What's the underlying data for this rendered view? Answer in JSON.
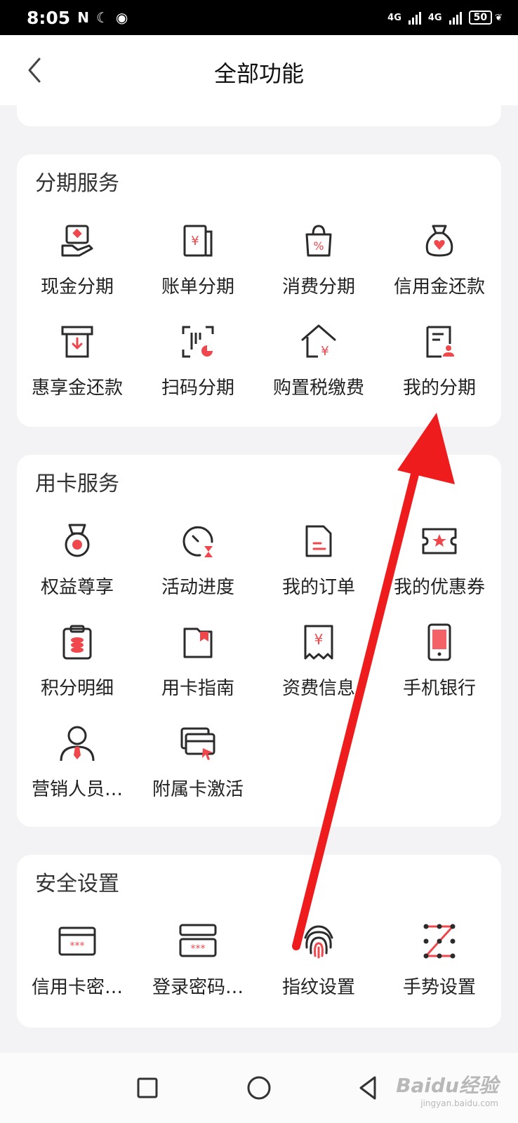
{
  "status_bar": {
    "time": "8:05",
    "network_1": "4G",
    "network_2": "4G",
    "battery": "50"
  },
  "header": {
    "title": "全部功能"
  },
  "sections": [
    {
      "title": "分期服务",
      "items": [
        {
          "label": "现金分期",
          "icon": "cash-installment-icon"
        },
        {
          "label": "账单分期",
          "icon": "bill-installment-icon"
        },
        {
          "label": "消费分期",
          "icon": "shopping-bag-icon"
        },
        {
          "label": "信用金还款",
          "icon": "money-bag-icon"
        },
        {
          "label": "惠享金还款",
          "icon": "atm-download-icon"
        },
        {
          "label": "扫码分期",
          "icon": "scan-code-icon"
        },
        {
          "label": "购置税缴费",
          "icon": "house-yen-icon"
        },
        {
          "label": "我的分期",
          "icon": "document-user-icon"
        }
      ]
    },
    {
      "title": "用卡服务",
      "items": [
        {
          "label": "权益尊享",
          "icon": "medal-icon"
        },
        {
          "label": "活动进度",
          "icon": "timer-icon"
        },
        {
          "label": "我的订单",
          "icon": "order-document-icon"
        },
        {
          "label": "我的优惠券",
          "icon": "coupon-icon"
        },
        {
          "label": "积分明细",
          "icon": "points-clipboard-icon"
        },
        {
          "label": "用卡指南",
          "icon": "guide-book-icon"
        },
        {
          "label": "资费信息",
          "icon": "fee-receipt-icon"
        },
        {
          "label": "手机银行",
          "icon": "mobile-phone-icon"
        },
        {
          "label": "营销人员…",
          "icon": "sales-person-icon"
        },
        {
          "label": "附属卡激活",
          "icon": "cards-activate-icon"
        }
      ]
    },
    {
      "title": "安全设置",
      "items": [
        {
          "label": "信用卡密…",
          "icon": "card-password-icon"
        },
        {
          "label": "登录密码…",
          "icon": "login-password-icon"
        },
        {
          "label": "指纹设置",
          "icon": "fingerprint-icon"
        },
        {
          "label": "手势设置",
          "icon": "gesture-pattern-icon"
        }
      ]
    }
  ],
  "watermark": {
    "text": "Baidu经验",
    "sub": "jingyan.baidu.com"
  },
  "colors": {
    "accent": "#f0474c",
    "annotation_arrow": "#ee1c1c",
    "stroke": "#2b2b2b"
  }
}
